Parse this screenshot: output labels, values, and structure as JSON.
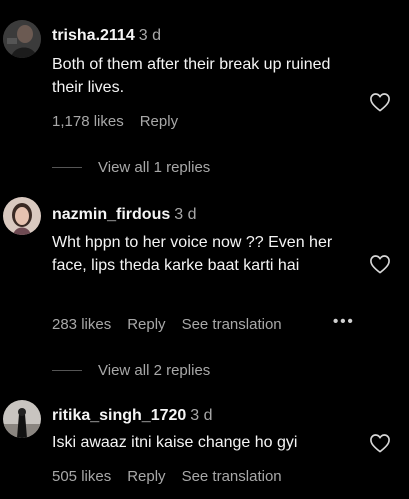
{
  "colors": {
    "background": "#000000",
    "primary_text": "#f5f5f5",
    "secondary_text": "#a8a8a8"
  },
  "comments": [
    {
      "username": "trisha.2114",
      "time": "3 d",
      "text": "Both of them after their break up ruined their lives.",
      "likes": "1,178 likes",
      "reply_label": "Reply",
      "view_replies": "View all 1 replies"
    },
    {
      "username": "nazmin_firdous",
      "time": "3 d",
      "text": "Wht hppn to her voice now ?? Even her face, lips theda karke baat karti hai",
      "likes": "283 likes",
      "reply_label": "Reply",
      "see_translation": "See translation",
      "more_label": "•••",
      "view_replies": "View all 2 replies"
    },
    {
      "username": "ritika_singh_1720",
      "time": "3 d",
      "text": "Iski awaaz itni kaise change ho gyi",
      "likes": "505 likes",
      "reply_label": "Reply",
      "see_translation": "See translation"
    }
  ]
}
